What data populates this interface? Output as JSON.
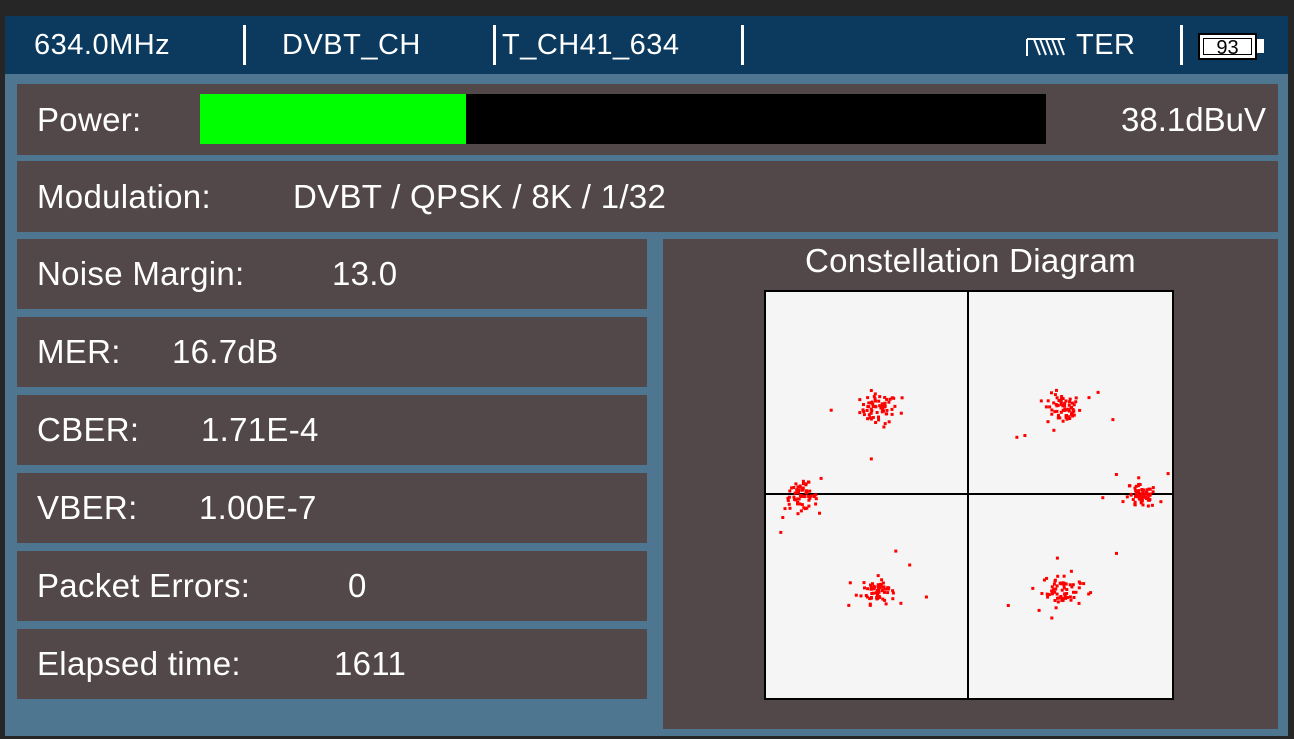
{
  "status_bar": {
    "frequency": "634.0MHz",
    "channel_plan": "DVBT_CH",
    "channel": "T_CH41_634",
    "antenna_icon": "antenna-icon",
    "band": "TER",
    "battery": "93",
    "battery_level": 0.93
  },
  "power": {
    "label": "Power:",
    "value": "38.1dBuV",
    "bar_fraction": 0.315,
    "bar_color": "#00ff00"
  },
  "modulation": {
    "label": "Modulation:",
    "value": "DVBT / QPSK / 8K / 1/32"
  },
  "measurements": [
    {
      "label": "Noise Margin:",
      "value": "13.0"
    },
    {
      "label": "MER:",
      "value": "16.7dB"
    },
    {
      "label": "CBER:",
      "value": "1.71E-4"
    },
    {
      "label": "VBER:",
      "value": "1.00E-7"
    },
    {
      "label": "Packet Errors:",
      "value": "0"
    },
    {
      "label": "Elapsed time:",
      "value": "1611"
    }
  ],
  "constellation": {
    "title": "Constellation Diagram",
    "point_color": "#ff0000",
    "clusters": [
      {
        "i": -0.45,
        "q": 0.43,
        "spread": 0.045
      },
      {
        "i": 0.45,
        "q": 0.43,
        "spread": 0.045
      },
      {
        "i": -0.45,
        "q": -0.46,
        "spread": 0.04
      },
      {
        "i": 0.45,
        "q": -0.46,
        "spread": 0.05
      },
      {
        "i": -0.83,
        "q": 0.0,
        "spread": 0.04
      },
      {
        "i": 0.84,
        "q": 0.0,
        "spread": 0.035
      }
    ]
  }
}
